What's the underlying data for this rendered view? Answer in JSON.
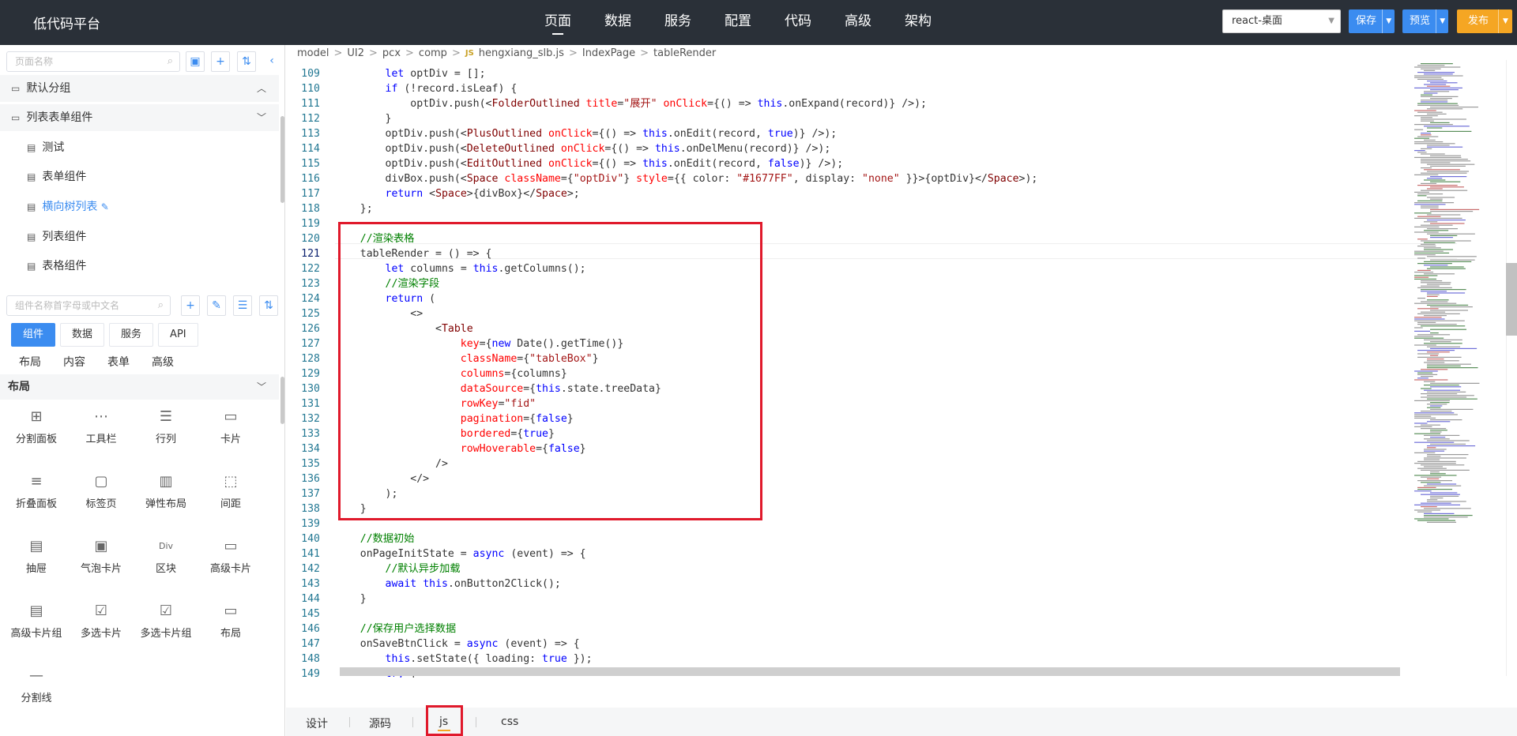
{
  "app_title": "低代码平台",
  "top_nav": [
    "页面",
    "数据",
    "服务",
    "配置",
    "代码",
    "高级",
    "架构"
  ],
  "top_nav_active": "页面",
  "env_select": "react-桌面",
  "buttons": {
    "save": "保存",
    "preview": "预览",
    "publish": "发布"
  },
  "left": {
    "page_search_placeholder": "页面名称",
    "groups": [
      {
        "label": "默认分组",
        "expanded": false
      },
      {
        "label": "列表表单组件",
        "expanded": true
      }
    ],
    "pages": [
      "测试",
      "表单组件",
      "横向树列表",
      "列表组件",
      "表格组件"
    ],
    "selected_page": "横向树列表",
    "comp_search_placeholder": "组件名称首字母或中文名",
    "tabs": [
      "组件",
      "数据",
      "服务",
      "API"
    ],
    "active_tab": "组件",
    "subtabs": [
      "布局",
      "内容",
      "表单",
      "高级"
    ],
    "section": "布局",
    "components": [
      "分割面板",
      "工具栏",
      "行列",
      "卡片",
      "折叠面板",
      "标签页",
      "弹性布局",
      "间距",
      "抽屉",
      "气泡卡片",
      "区块",
      "高级卡片",
      "高级卡片组",
      "多选卡片",
      "多选卡片组",
      "布局",
      "分割线"
    ]
  },
  "breadcrumb": [
    "model",
    "UI2",
    "pcx",
    "comp",
    "hengxiang_slb.js",
    "IndexPage",
    "tableRender"
  ],
  "code": [
    {
      "n": "109",
      "html": "        <span class='k'>let</span> optDiv = [];"
    },
    {
      "n": "110",
      "html": "        <span class='k'>if</span> (!record.isLeaf) {"
    },
    {
      "n": "111",
      "html": "            optDiv.push(&lt;<span class='t'>FolderOutlined</span> <span class='a'>title</span>=<span class='s'>\"展开\"</span> <span class='a'>onClick</span>={() =&gt; <span class='k'>this</span>.onExpand(record)} /&gt;);"
    },
    {
      "n": "112",
      "html": "        }"
    },
    {
      "n": "113",
      "html": "        optDiv.push(&lt;<span class='t'>PlusOutlined</span> <span class='a'>onClick</span>={() =&gt; <span class='k'>this</span>.onEdit(record, <span class='k'>true</span>)} /&gt;);"
    },
    {
      "n": "114",
      "html": "        optDiv.push(&lt;<span class='t'>DeleteOutlined</span> <span class='a'>onClick</span>={() =&gt; <span class='k'>this</span>.onDelMenu(record)} /&gt;);"
    },
    {
      "n": "115",
      "html": "        optDiv.push(&lt;<span class='t'>EditOutlined</span> <span class='a'>onClick</span>={() =&gt; <span class='k'>this</span>.onEdit(record, <span class='k'>false</span>)} /&gt;);"
    },
    {
      "n": "116",
      "html": "        divBox.push(&lt;<span class='t'>Space</span> <span class='a'>className</span>={<span class='s'>\"optDiv\"</span>} <span class='a'>style</span>={{ color: <span class='s'>\"#1677FF\"</span>, display: <span class='s'>\"none\"</span> }}&gt;{optDiv}&lt;/<span class='t'>Space</span>&gt;);"
    },
    {
      "n": "117",
      "html": "        <span class='k'>return</span> &lt;<span class='t'>Space</span>&gt;{divBox}&lt;/<span class='t'>Space</span>&gt;;"
    },
    {
      "n": "118",
      "html": "    };"
    },
    {
      "n": "119",
      "html": ""
    },
    {
      "n": "120",
      "html": "    <span class='c'>//渲染表格</span>"
    },
    {
      "n": "121",
      "html": "    tableRender = () =&gt; {"
    },
    {
      "n": "122",
      "html": "        <span class='k'>let</span> columns = <span class='k'>this</span>.getColumns();"
    },
    {
      "n": "123",
      "html": "        <span class='c'>//渲染字段</span>"
    },
    {
      "n": "124",
      "html": "        <span class='k'>return</span> ("
    },
    {
      "n": "125",
      "html": "            &lt;&gt;"
    },
    {
      "n": "126",
      "html": "                &lt;<span class='t'>Table</span>"
    },
    {
      "n": "127",
      "html": "                    <span class='a'>key</span>={<span class='k'>new</span> Date().getTime()}"
    },
    {
      "n": "128",
      "html": "                    <span class='a'>className</span>={<span class='s'>\"tableBox\"</span>}"
    },
    {
      "n": "129",
      "html": "                    <span class='a'>columns</span>={columns}"
    },
    {
      "n": "130",
      "html": "                    <span class='a'>dataSource</span>={<span class='k'>this</span>.state.treeData}"
    },
    {
      "n": "131",
      "html": "                    <span class='a'>rowKey</span>=<span class='s'>\"fid\"</span>"
    },
    {
      "n": "132",
      "html": "                    <span class='a'>pagination</span>={<span class='k'>false</span>}"
    },
    {
      "n": "133",
      "html": "                    <span class='a'>bordered</span>={<span class='k'>true</span>}"
    },
    {
      "n": "134",
      "html": "                    <span class='a'>rowHoverable</span>={<span class='k'>false</span>}"
    },
    {
      "n": "135",
      "html": "                /&gt;"
    },
    {
      "n": "136",
      "html": "            &lt;/&gt;"
    },
    {
      "n": "137",
      "html": "        );"
    },
    {
      "n": "138",
      "html": "    }"
    },
    {
      "n": "139",
      "html": ""
    },
    {
      "n": "140",
      "html": "    <span class='c'>//数据初始</span>"
    },
    {
      "n": "141",
      "html": "    onPageInitState = <span class='k'>async</span> (event) =&gt; {"
    },
    {
      "n": "142",
      "html": "        <span class='c'>//默认异步加载</span>"
    },
    {
      "n": "143",
      "html": "        <span class='k'>await</span> <span class='k'>this</span>.onButton2Click();"
    },
    {
      "n": "144",
      "html": "    }"
    },
    {
      "n": "145",
      "html": ""
    },
    {
      "n": "146",
      "html": "    <span class='c'>//保存用户选择数据</span>"
    },
    {
      "n": "147",
      "html": "    onSaveBtnClick = <span class='k'>async</span> (event) =&gt; {"
    },
    {
      "n": "148",
      "html": "        <span class='k'>this</span>.setState({ loading: <span class='k'>true</span> });"
    },
    {
      "n": "149",
      "html": "        <span class='k'>try</span> {"
    }
  ],
  "current_line": "121",
  "bottom_tabs": [
    "设计",
    "源码",
    "js",
    "css"
  ],
  "bottom_active": "js",
  "colors": {
    "topbar": "#2a3038",
    "accent": "#3b8cf0",
    "publish": "#f5a623",
    "highlight": "#e0192b"
  }
}
